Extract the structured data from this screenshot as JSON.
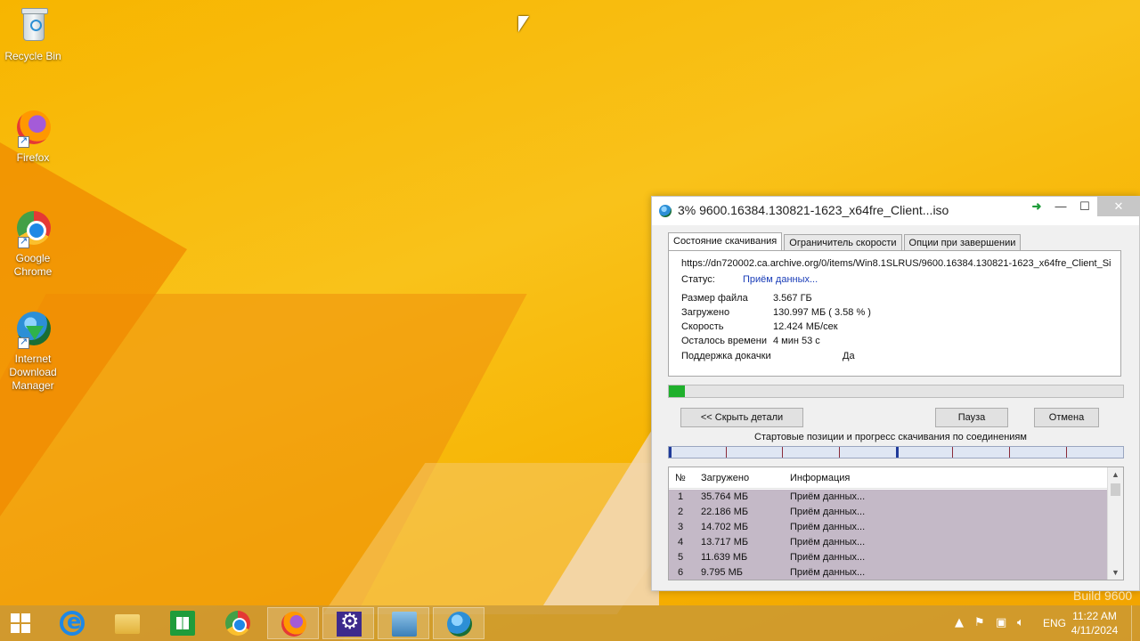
{
  "desktop": {
    "icons": [
      {
        "label": "Recycle Bin"
      },
      {
        "label": "Firefox"
      },
      {
        "label": "Google Chrome"
      },
      {
        "label": "Internet Download Manager"
      }
    ],
    "watermark": "Build 9600"
  },
  "window": {
    "title": "3% 9600.16384.130821-1623_x64fre_Client...iso",
    "tabs": [
      "Состояние скачивания",
      "Ограничитель скорости",
      "Опции при завершении"
    ],
    "url": "https://dn720002.ca.archive.org/0/items/Win8.1SLRUS/9600.16384.130821-1623_x64fre_Client_Si",
    "status_label": "Статус:",
    "status_value": "Приём данных...",
    "details": [
      {
        "key": "Размер файла",
        "value": "3.567  ГБ"
      },
      {
        "key": "Загружено",
        "value": "130.997  МБ  ( 3.58 % )"
      },
      {
        "key": "Скорость",
        "value": "12.424  МБ/сек"
      },
      {
        "key": "Осталось времени",
        "value": "4 мин 53 с"
      },
      {
        "key": "Поддержка докачки",
        "value": "Да"
      }
    ],
    "progress_fraction": 0.0358,
    "buttons": {
      "hide_details": "<< Скрыть детали",
      "pause": "Пауза",
      "cancel": "Отмена"
    },
    "connections_label": "Стартовые позиции и прогресс скачивания по соединениям",
    "list": {
      "headers": [
        "№",
        "Загружено",
        "Информация"
      ],
      "rows": [
        {
          "n": "1",
          "downloaded": "35.764  МБ",
          "info": "Приём данных..."
        },
        {
          "n": "2",
          "downloaded": "22.186  МБ",
          "info": "Приём данных..."
        },
        {
          "n": "3",
          "downloaded": "14.702  МБ",
          "info": "Приём данных..."
        },
        {
          "n": "4",
          "downloaded": "13.717  МБ",
          "info": "Приём данных..."
        },
        {
          "n": "5",
          "downloaded": "11.639  МБ",
          "info": "Приём данных..."
        },
        {
          "n": "6",
          "downloaded": "9.795  МБ",
          "info": "Приём данных..."
        }
      ]
    }
  },
  "taskbar": {
    "items": [
      "ie-icon",
      "file-explorer-icon",
      "store-icon",
      "chrome-icon",
      "firefox-icon",
      "settings-icon",
      "control-panel-icon",
      "idm-icon"
    ],
    "language": "ENG",
    "time": "11:22 AM",
    "date": "4/11/2024"
  }
}
